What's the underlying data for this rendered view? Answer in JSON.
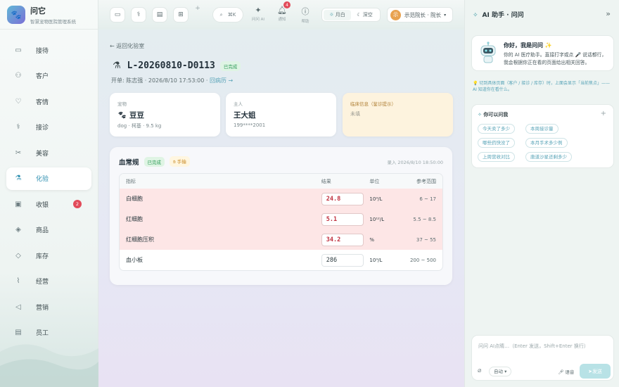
{
  "brand": {
    "name": "问它",
    "subtitle": "智慧宠物医院管理系统"
  },
  "nav": [
    {
      "label": "接待",
      "icon": "inbox-icon"
    },
    {
      "label": "客户",
      "icon": "users-icon"
    },
    {
      "label": "客情",
      "icon": "heart-icon"
    },
    {
      "label": "接诊",
      "icon": "stethoscope-icon"
    },
    {
      "label": "美容",
      "icon": "scissors-icon"
    },
    {
      "label": "化验",
      "icon": "flask-icon",
      "active": true
    },
    {
      "label": "收银",
      "icon": "cashier-icon",
      "badge": "2"
    },
    {
      "label": "商品",
      "icon": "box-icon"
    },
    {
      "label": "库存",
      "icon": "layers-icon"
    },
    {
      "label": "经营",
      "icon": "chart-icon"
    },
    {
      "label": "营销",
      "icon": "megaphone-icon"
    },
    {
      "label": "员工",
      "icon": "id-card-icon"
    }
  ],
  "topbar": {
    "search_shortcut": "⌘K",
    "plus": "+",
    "ask_ai": "问问 AI",
    "notifications": "通知",
    "notification_count": "4",
    "help": "帮助",
    "theme_day": "月白",
    "theme_night": "深空",
    "user_avatar": "示",
    "user_label": "示范院长 · 院长"
  },
  "page": {
    "back": "返回化验室",
    "title": "L-20260810-D0113",
    "status": "已完成",
    "meta_prefix": "开单: 陈志强 · 2026/8/10 17:53:00 ·",
    "meta_link": "回病历 →"
  },
  "cards": {
    "pet": {
      "label": "宠物",
      "name": "豆豆",
      "detail": "dog · 柯基 · 9.5 kg"
    },
    "owner": {
      "label": "主人",
      "name": "王大姐",
      "phone": "199****2001"
    },
    "clinical": {
      "label": "临床信息（鉴诊提示）",
      "value": "未填"
    }
  },
  "panel": {
    "title": "血常规",
    "status": "已完成",
    "source": "手输",
    "entered": "录入 2026/8/10 18:50:00",
    "headers": {
      "name": "指标",
      "value": "结果",
      "unit": "单位",
      "range": "参考范围"
    },
    "rows": [
      {
        "name": "白细胞",
        "value": "24.8",
        "unit": "10⁹/L",
        "range": "6 ~ 17",
        "abnormal": true
      },
      {
        "name": "红细胞",
        "value": "5.1",
        "unit": "10¹²/L",
        "range": "5.5 ~ 8.5",
        "abnormal": true
      },
      {
        "name": "红细胞压积",
        "value": "34.2",
        "unit": "%",
        "range": "37 ~ 55",
        "abnormal": true
      },
      {
        "name": "血小板",
        "value": "286",
        "unit": "10⁹/L",
        "range": "200 ~ 500",
        "abnormal": false
      }
    ]
  },
  "ai": {
    "title": "AI 助手 · 问问",
    "greeting": "你好，我是问问 ✨",
    "intro": "你的 AI 医疗助手。直接打字或点 🎤 说话都行，我会根据你正在看的页面给出相关回答。",
    "tip": "💡 切到具体页面（客户 / 接诊 / 库存）时，上面会显示「当前焦点」—— AI 知道你在看什么。",
    "suggest_title": "你可以问我",
    "suggestions": [
      "今天卖了多少",
      "本周接诊量",
      "哪些药快没了",
      "本月手术多少例",
      "上周营收对比",
      "唐道沙星还剩多少"
    ],
    "placeholder": "问问 AI点睛…（Enter 发送，Shift+Enter 换行）",
    "mode": "自动",
    "voice": "语音",
    "send": "发送"
  }
}
